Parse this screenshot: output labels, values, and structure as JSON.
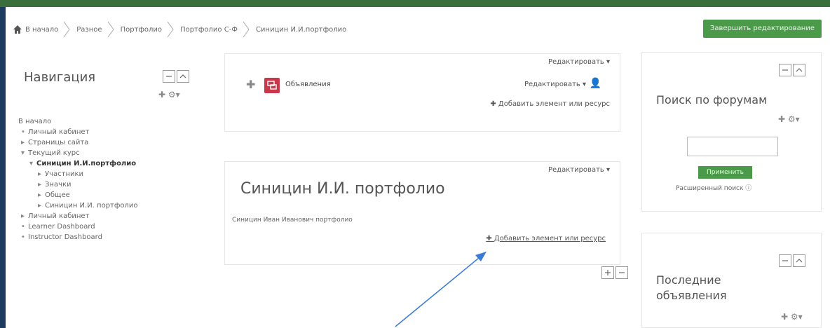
{
  "breadcrumb": {
    "items": [
      "В начало",
      "Разное",
      "Портфолио",
      "Портфолио С-Ф",
      "Синицин И.И.портфолио"
    ]
  },
  "header": {
    "finish_editing": "Завершить редактирование"
  },
  "navigation": {
    "title": "Навигация",
    "items": [
      {
        "label": "В начало"
      },
      {
        "label": "Личный кабинет"
      },
      {
        "label": "Страницы сайта"
      },
      {
        "label": "Текущий курс"
      },
      {
        "label": "Синицин И.И.портфолио"
      },
      {
        "label": "Участники"
      },
      {
        "label": "Значки"
      },
      {
        "label": "Общее"
      },
      {
        "label": "Синицин И.И. портфолио"
      },
      {
        "label": "Личный кабинет"
      },
      {
        "label": "Learner Dashboard"
      },
      {
        "label": "Instructor Dashboard"
      }
    ]
  },
  "announcements_section": {
    "edit_label": "Редактировать ▾",
    "item_edit_label": "Редактировать ▾",
    "item_name": "Объявления",
    "add_resource": "Добавить элемент или ресурс"
  },
  "course_section": {
    "edit_label": "Редактировать ▾",
    "title": "Синицин И.И. портфолио",
    "description": "Синицин Иван Иванович портфолио",
    "add_resource": "Добавить элемент или ресурс"
  },
  "forum_search": {
    "title": "Поиск по форумам",
    "apply_label": "Применить",
    "advanced_label": "Расширенный поиск"
  },
  "news": {
    "title": "Последние объявления"
  },
  "colors": {
    "accent_green": "#4a9a4a",
    "top_bar": "#3b6e3b",
    "arrow": "#3a7bd5"
  }
}
